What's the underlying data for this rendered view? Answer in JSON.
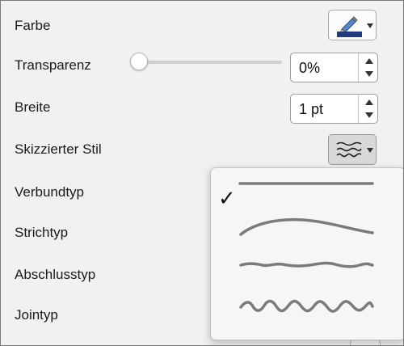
{
  "properties": {
    "color_label": "Farbe",
    "transparency_label": "Transparenz",
    "width_label": "Breite",
    "sketch_style_label": "Skizzierter Stil",
    "compound_type_label": "Verbundtyp",
    "dash_type_label": "Strichtyp",
    "cap_type_label": "Abschlusstyp",
    "join_type_label": "Jointyp"
  },
  "color": {
    "current": "#1f3a7a",
    "icon": "pencil-icon"
  },
  "transparency": {
    "value": "0%",
    "slider_fraction": 0.0
  },
  "width": {
    "value": "1 pt"
  },
  "sketch_style": {
    "icon": "scribble-icon",
    "options": [
      {
        "name": "straight",
        "selected": true
      },
      {
        "name": "curved",
        "selected": false
      },
      {
        "name": "freehand",
        "selected": false
      },
      {
        "name": "scribble",
        "selected": false
      }
    ],
    "check_mark": "✓"
  },
  "colors": {
    "line_sample": "#7b7b7b",
    "panel_bg": "#f1f1f1"
  }
}
